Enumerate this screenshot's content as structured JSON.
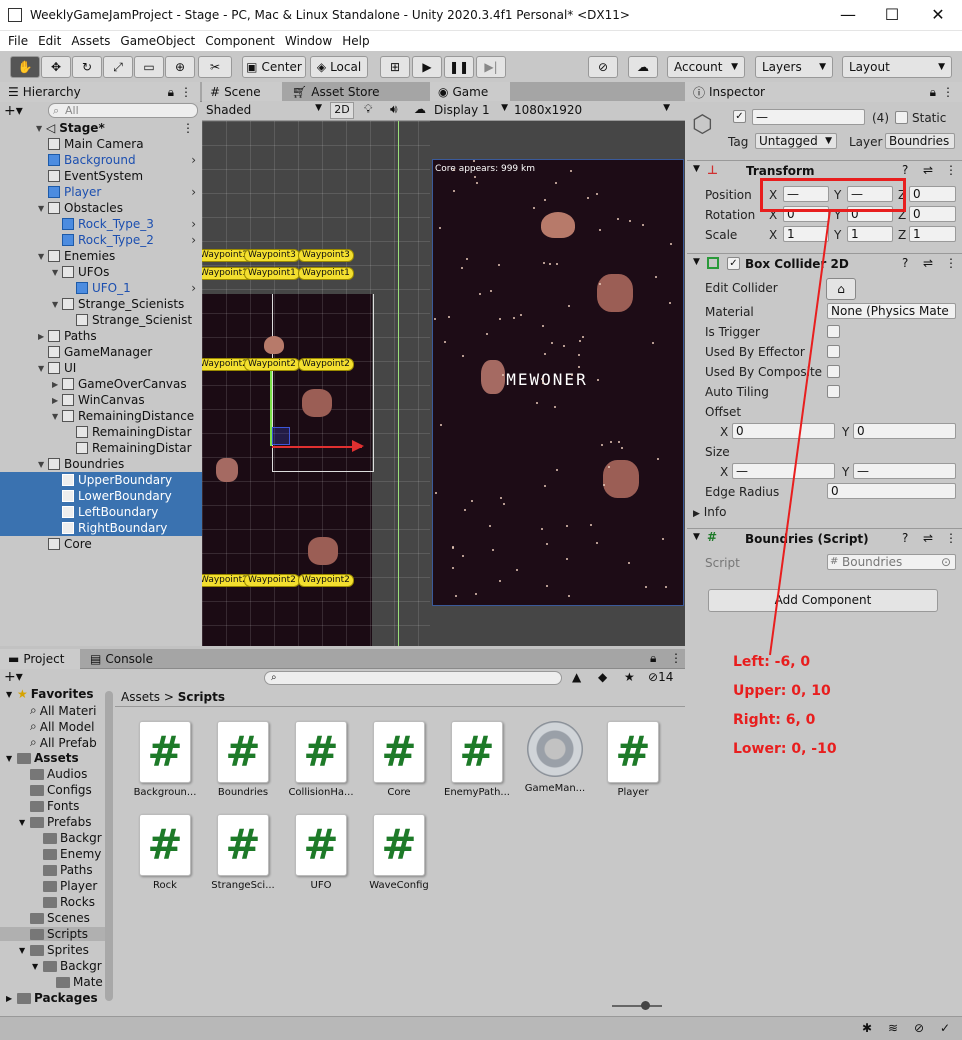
{
  "window": {
    "title": "WeeklyGameJamProject - Stage - PC, Mac & Linux Standalone - Unity 2020.3.4f1 Personal* <DX11>"
  },
  "menu": [
    "File",
    "Edit",
    "Assets",
    "GameObject",
    "Component",
    "Window",
    "Help"
  ],
  "toolbar": {
    "pivot": "Center",
    "space": "Local",
    "account": "Account",
    "layers": "Layers",
    "layout": "Layout"
  },
  "hierarchy": {
    "tab": "Hierarchy",
    "search_placeholder": "All",
    "scene": "Stage*",
    "items": [
      {
        "label": "Main Camera",
        "prefab": false
      },
      {
        "label": "Background",
        "prefab": true
      },
      {
        "label": "EventSystem",
        "prefab": false
      },
      {
        "label": "Player",
        "prefab": true
      },
      {
        "label": "Obstacles",
        "prefab": false
      },
      {
        "label": "Rock_Type_3",
        "prefab": true
      },
      {
        "label": "Rock_Type_2",
        "prefab": true
      },
      {
        "label": "Enemies",
        "prefab": false
      },
      {
        "label": "UFOs",
        "prefab": false
      },
      {
        "label": "UFO_1",
        "prefab": true
      },
      {
        "label": "Strange_Scienists",
        "prefab": false
      },
      {
        "label": "Strange_Scienist",
        "prefab": false
      },
      {
        "label": "Paths",
        "prefab": false
      },
      {
        "label": "GameManager",
        "prefab": false
      },
      {
        "label": "UI",
        "prefab": false
      },
      {
        "label": "GameOverCanvas",
        "prefab": false
      },
      {
        "label": "WinCanvas",
        "prefab": false
      },
      {
        "label": "RemainingDistance",
        "prefab": false
      },
      {
        "label": "RemainingDistar",
        "prefab": false
      },
      {
        "label": "RemainingDistar",
        "prefab": false
      },
      {
        "label": "Boundries",
        "prefab": false
      },
      {
        "label": "UpperBoundary",
        "prefab": false
      },
      {
        "label": "LowerBoundary",
        "prefab": false
      },
      {
        "label": "LeftBoundary",
        "prefab": false
      },
      {
        "label": "RightBoundary",
        "prefab": false
      },
      {
        "label": "Core",
        "prefab": false
      }
    ]
  },
  "scene": {
    "tab": "Scene",
    "asset_store_tab": "Asset Store",
    "shading": "Shaded",
    "mode": "2D",
    "waypoints": [
      "Waypoint3",
      "Waypoint3",
      "Waypoint3",
      "Waypoint1",
      "Waypoint1",
      "Waypoint1",
      "Waypoint2",
      "Waypoint2",
      "Waypoint2",
      "Waypoint2",
      "Waypoint2",
      "Waypoint2"
    ]
  },
  "game": {
    "tab": "Game",
    "display": "Display 1",
    "resolution": "1080x1920",
    "hud_text": "Core appears: 999 km",
    "overlay_text": "GAMEWONER"
  },
  "inspector": {
    "tab": "Inspector",
    "name": "—",
    "count": "(4)",
    "static_label": "Static",
    "tag_label": "Tag",
    "tag": "Untagged",
    "layer_label": "Layer",
    "layer": "Boundries",
    "transform": {
      "title": "Transform",
      "position_label": "Position",
      "rotation_label": "Rotation",
      "scale_label": "Scale",
      "position": {
        "x": "—",
        "y": "—",
        "z": "0"
      },
      "rotation": {
        "x": "0",
        "y": "0",
        "z": "0"
      },
      "scale": {
        "x": "1",
        "y": "1",
        "z": "1"
      }
    },
    "box_collider": {
      "title": "Box Collider 2D",
      "edit_collider": "Edit Collider",
      "material_label": "Material",
      "material": "None (Physics Mate",
      "is_trigger": "Is Trigger",
      "used_by_effector": "Used By Effector",
      "used_by_composite": "Used By Composite",
      "auto_tiling": "Auto Tiling",
      "offset_label": "Offset",
      "offset": {
        "x": "0",
        "y": "0"
      },
      "size_label": "Size",
      "size": {
        "x": "—",
        "y": "—"
      },
      "edge_radius_label": "Edge Radius",
      "edge_radius": "0",
      "info": "Info"
    },
    "script": {
      "title": "Boundries (Script)",
      "label": "Script",
      "value": "Boundries"
    },
    "add_component": "Add Component"
  },
  "annotations": [
    "Left: -6, 0",
    "Upper: 0, 10",
    "Right: 6, 0",
    "Lower: 0, -10"
  ],
  "project": {
    "tab": "Project",
    "console_tab": "Console",
    "hidden_count": "14",
    "breadcrumb": [
      "Assets",
      "Scripts"
    ],
    "tree": [
      {
        "label": "Favorites",
        "level": 0,
        "bold": true
      },
      {
        "label": "All Materi",
        "level": 1
      },
      {
        "label": "All Model",
        "level": 1
      },
      {
        "label": "All Prefab",
        "level": 1
      },
      {
        "label": "Assets",
        "level": 0,
        "bold": true
      },
      {
        "label": "Audios",
        "level": 1
      },
      {
        "label": "Configs",
        "level": 1
      },
      {
        "label": "Fonts",
        "level": 1
      },
      {
        "label": "Prefabs",
        "level": 1
      },
      {
        "label": "Backgr",
        "level": 2
      },
      {
        "label": "Enemy",
        "level": 2
      },
      {
        "label": "Paths",
        "level": 2
      },
      {
        "label": "Player",
        "level": 2
      },
      {
        "label": "Rocks",
        "level": 2
      },
      {
        "label": "Scenes",
        "level": 1
      },
      {
        "label": "Scripts",
        "level": 1
      },
      {
        "label": "Sprites",
        "level": 1
      },
      {
        "label": "Backgr",
        "level": 2
      },
      {
        "label": "Mate",
        "level": 3
      },
      {
        "label": "Packages",
        "level": 0,
        "bold": true
      }
    ],
    "assets": [
      "Backgroun...",
      "Boundries",
      "CollisionHa...",
      "Core",
      "EnemyPath...",
      "GameMan...",
      "Player",
      "Rock",
      "StrangeSci...",
      "UFO",
      "WaveConfig"
    ]
  },
  "colors": {
    "selection": "#3a72b0",
    "annotation": "#e81e1e",
    "prefab_text": "#1c4fb0",
    "csharp": "#1d7a28"
  }
}
